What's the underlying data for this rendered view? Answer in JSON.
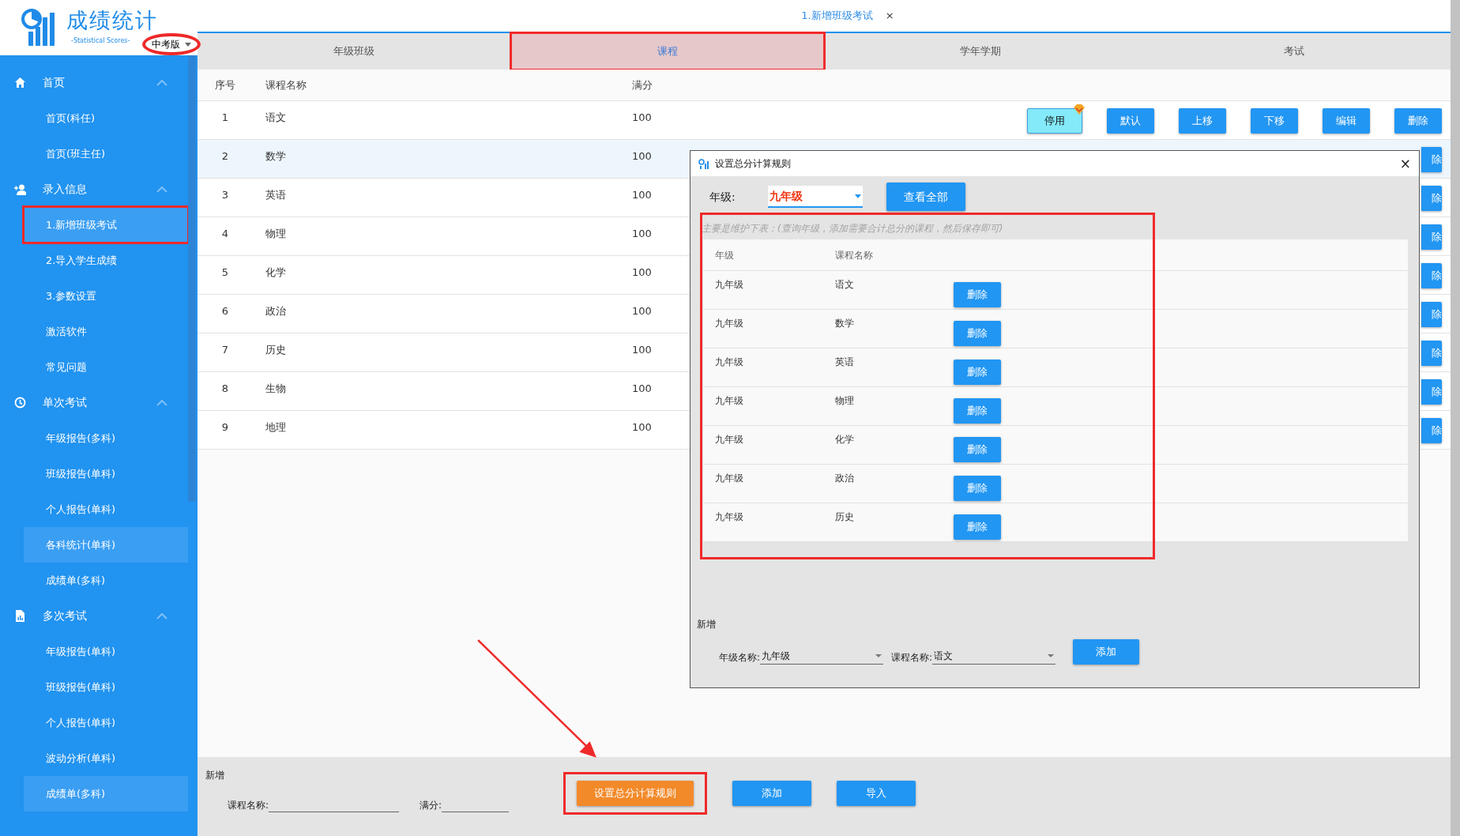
{
  "logo": {
    "title": "成绩统计",
    "subtitle": "-Statistical Scores-",
    "edition": "中考版",
    "edition_annotated": true
  },
  "sidebar": {
    "groups": [
      {
        "label": "首页",
        "expanded": true,
        "items": [
          {
            "label": "首页(科任)",
            "selected": false,
            "highlighted": false,
            "annotated": false
          },
          {
            "label": "首页(班主任)",
            "selected": false,
            "highlighted": false,
            "annotated": false
          }
        ]
      },
      {
        "label": "录入信息",
        "expanded": true,
        "items": [
          {
            "label": "1.新增班级考试",
            "selected": true,
            "highlighted": false,
            "annotated": true
          },
          {
            "label": "2.导入学生成绩",
            "selected": false,
            "highlighted": false,
            "annotated": false
          },
          {
            "label": "3.参数设置",
            "selected": false,
            "highlighted": false,
            "annotated": false
          },
          {
            "label": "激活软件",
            "selected": false,
            "highlighted": false,
            "annotated": false
          },
          {
            "label": "常见问题",
            "selected": false,
            "highlighted": false,
            "annotated": false
          }
        ]
      },
      {
        "label": "单次考试",
        "expanded": true,
        "items": [
          {
            "label": "年级报告(多科)",
            "selected": false,
            "highlighted": false,
            "annotated": false
          },
          {
            "label": "班级报告(单科)",
            "selected": false,
            "highlighted": false,
            "annotated": false
          },
          {
            "label": "个人报告(单科)",
            "selected": false,
            "highlighted": false,
            "annotated": false
          },
          {
            "label": "各科统计(单科)",
            "selected": false,
            "highlighted": true,
            "annotated": false
          },
          {
            "label": "成绩单(多科)",
            "selected": false,
            "highlighted": false,
            "annotated": false
          }
        ]
      },
      {
        "label": "多次考试",
        "expanded": true,
        "items": [
          {
            "label": "年级报告(单科)",
            "selected": false,
            "highlighted": false,
            "annotated": false
          },
          {
            "label": "班级报告(单科)",
            "selected": false,
            "highlighted": false,
            "annotated": false
          },
          {
            "label": "个人报告(单科)",
            "selected": false,
            "highlighted": false,
            "annotated": false
          },
          {
            "label": "波动分析(单科)",
            "selected": false,
            "highlighted": false,
            "annotated": false
          },
          {
            "label": "成绩单(多科)",
            "selected": false,
            "highlighted": true,
            "annotated": false
          }
        ]
      }
    ]
  },
  "page_tab": {
    "label": "1.新增班级考试",
    "close": "×"
  },
  "tabs": [
    {
      "label": "年级班级",
      "selected": false,
      "annotated": false
    },
    {
      "label": "课程",
      "selected": true,
      "annotated": true
    },
    {
      "label": "学年学期",
      "selected": false,
      "annotated": false
    },
    {
      "label": "考试",
      "selected": false,
      "annotated": false
    }
  ],
  "table": {
    "columns": [
      "序号",
      "课程名称",
      "满分"
    ],
    "rows": [
      {
        "cells": [
          "1",
          "语文",
          "100"
        ],
        "highlighted": false,
        "actions": [
          {
            "label": "停用",
            "kind": "toggle"
          },
          {
            "label": "默认",
            "kind": "action"
          },
          {
            "label": "上移",
            "kind": "action"
          },
          {
            "label": "下移",
            "kind": "action"
          },
          {
            "label": "编辑",
            "kind": "action"
          },
          {
            "label": "删除",
            "kind": "action"
          }
        ]
      },
      {
        "cells": [
          "2",
          "数学",
          "100"
        ],
        "highlighted": true,
        "actions": [
          {
            "label": "除",
            "kind": "clipped"
          }
        ]
      },
      {
        "cells": [
          "3",
          "英语",
          "100"
        ],
        "highlighted": false,
        "actions": [
          {
            "label": "除",
            "kind": "clipped"
          }
        ]
      },
      {
        "cells": [
          "4",
          "物理",
          "100"
        ],
        "highlighted": false,
        "actions": [
          {
            "label": "除",
            "kind": "clipped"
          }
        ]
      },
      {
        "cells": [
          "5",
          "化学",
          "100"
        ],
        "highlighted": false,
        "actions": [
          {
            "label": "除",
            "kind": "clipped"
          }
        ]
      },
      {
        "cells": [
          "6",
          "政治",
          "100"
        ],
        "highlighted": false,
        "actions": [
          {
            "label": "除",
            "kind": "clipped"
          }
        ]
      },
      {
        "cells": [
          "7",
          "历史",
          "100"
        ],
        "highlighted": false,
        "actions": [
          {
            "label": "除",
            "kind": "clipped"
          }
        ]
      },
      {
        "cells": [
          "8",
          "生物",
          "100"
        ],
        "highlighted": false,
        "actions": [
          {
            "label": "除",
            "kind": "clipped"
          }
        ]
      },
      {
        "cells": [
          "9",
          "地理",
          "100"
        ],
        "highlighted": false,
        "actions": [
          {
            "label": "除",
            "kind": "clipped"
          }
        ]
      }
    ]
  },
  "bottom": {
    "title": "新增",
    "fields": [
      {
        "label": "课程名称:"
      },
      {
        "label": "满分:"
      }
    ],
    "buttons": [
      {
        "label": "设置总分计算规则",
        "kind": "accent"
      },
      {
        "label": "添加",
        "kind": "primary"
      },
      {
        "label": "导入",
        "kind": "primary"
      }
    ],
    "rule_annotated": true
  },
  "dialog": {
    "title": "设置总分计算规则",
    "close": "×",
    "grade_label": "年级:",
    "grade_value": "九年级",
    "view_all": "查看全部",
    "hint": "主要是维护下表：(查询年级，添加需要合计总分的课程，然后保存即可)",
    "list_annotated": true,
    "columns": [
      "年级",
      "课程名称"
    ],
    "rows": [
      {
        "cells": [
          "九年级",
          "语文"
        ],
        "action": "删除"
      },
      {
        "cells": [
          "九年级",
          "数学"
        ],
        "action": "删除"
      },
      {
        "cells": [
          "九年级",
          "英语"
        ],
        "action": "删除"
      },
      {
        "cells": [
          "九年级",
          "物理"
        ],
        "action": "删除"
      },
      {
        "cells": [
          "九年级",
          "化学"
        ],
        "action": "删除"
      },
      {
        "cells": [
          "九年级",
          "政治"
        ],
        "action": "删除"
      },
      {
        "cells": [
          "九年级",
          "历史"
        ],
        "action": "删除"
      }
    ],
    "add": {
      "title": "新增",
      "fields": [
        {
          "label": "年级名称:",
          "value": "九年级"
        },
        {
          "label": "课程名称:",
          "value": "语文"
        }
      ],
      "button": "添加"
    }
  },
  "annotation_arrow": true
}
